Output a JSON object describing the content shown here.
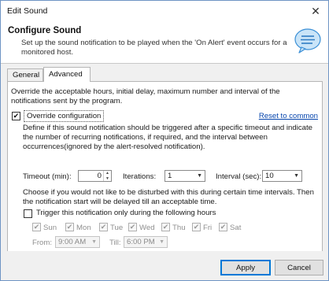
{
  "window": {
    "title": "Edit Sound"
  },
  "header": {
    "title": "Configure Sound",
    "description": "Set up the sound notification to be played when the 'On Alert' event occurs for a monitored host."
  },
  "tabs": [
    {
      "label": "General",
      "active": false
    },
    {
      "label": "Advanced",
      "active": true
    }
  ],
  "advanced": {
    "intro": "Override the acceptable hours, initial delay, maximum number and interval of the notifications sent by the program.",
    "override": {
      "label": "Override configuration",
      "checked": true
    },
    "reset_link": "Reset to common",
    "description": "Define if this sound notification should be triggered after a specific timeout and indicate the number of recurring notifications, if required, and the interval between occurrences(ignored by the alert-resolved notification).",
    "timeout": {
      "label": "Timeout (min):",
      "value": "0"
    },
    "iterations": {
      "label": "Iterations:",
      "value": "1"
    },
    "interval": {
      "label": "Interval (sec):",
      "value": "10"
    },
    "time_description": "Choose if you would not like to be disturbed with this during certain time intervals. Then the notification start will be delayed till an acceptable time.",
    "trigger": {
      "label": "Trigger this notification only during the following hours",
      "checked": false
    },
    "days": [
      {
        "label": "Sun",
        "checked": true
      },
      {
        "label": "Mon",
        "checked": true
      },
      {
        "label": "Tue",
        "checked": true
      },
      {
        "label": "Wed",
        "checked": true
      },
      {
        "label": "Thu",
        "checked": true
      },
      {
        "label": "Fri",
        "checked": true
      },
      {
        "label": "Sat",
        "checked": true
      }
    ],
    "from": {
      "label": "From:",
      "value": "9:00 AM"
    },
    "till": {
      "label": "Till:",
      "value": "6:00 PM"
    }
  },
  "footer": {
    "apply_label": "Apply",
    "cancel_label": "Cancel"
  }
}
